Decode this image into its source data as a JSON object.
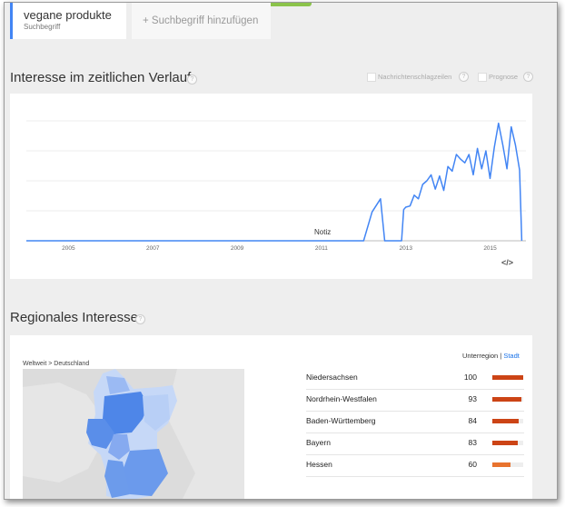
{
  "search": {
    "term": "vegane produkte",
    "term_type": "Suchbegriff",
    "add_term": "+ Suchbegriff hinzufügen"
  },
  "time_section": {
    "title": "Interesse im zeitlichen Verlauf",
    "help_icon": "?",
    "options": [
      "Nachrichtenschlagzeilen",
      "Prognose"
    ],
    "note_label": "Notiz",
    "embed_icon": "</>"
  },
  "chart_data": {
    "type": "line",
    "series": [
      {
        "color": "#4285f4",
        "x": [
          2004.0,
          2012.0,
          2012.2,
          2012.4,
          2012.5,
          2012.7,
          2012.9,
          2012.95,
          2013.0,
          2013.1,
          2013.2,
          2013.3,
          2013.4,
          2013.5,
          2013.6,
          2013.7,
          2013.8,
          2013.9,
          2014.0,
          2014.1,
          2014.2,
          2014.3,
          2014.4,
          2014.5,
          2014.6,
          2014.7,
          2014.8,
          2014.9,
          2015.0,
          2015.1,
          2015.2,
          2015.3,
          2015.4,
          2015.5,
          2015.6,
          2015.7,
          2015.75
        ],
        "values": [
          0,
          0,
          24,
          35,
          0,
          0,
          0,
          26,
          28,
          29,
          38,
          35,
          47,
          50,
          55,
          43,
          54,
          42,
          62,
          58,
          72,
          68,
          65,
          72,
          55,
          77,
          60,
          75,
          52,
          78,
          98,
          80,
          60,
          95,
          80,
          59,
          0
        ]
      }
    ],
    "x_ticks": [
      "2005",
      "2007",
      "2009",
      "2011",
      "2013",
      "2015"
    ],
    "x_tick_values": [
      2005,
      2007,
      2009,
      2011,
      2013,
      2015
    ],
    "xlim": [
      2004.0,
      2015.85
    ],
    "ylim": [
      0,
      100
    ],
    "grid": true
  },
  "region_section": {
    "title": "Regionales Interesse",
    "help_icon": "?",
    "breadcrumb": "Weltweit > Deutschland",
    "toggle_region": "Unterregion",
    "toggle_city": "Stadt",
    "rows": [
      {
        "name": "Niedersachsen",
        "value": "100",
        "level": 1.0,
        "color": "#cc4416"
      },
      {
        "name": "Nordrhein-Westfalen",
        "value": "93",
        "level": 0.93,
        "color": "#cc4416"
      },
      {
        "name": "Baden-Württemberg",
        "value": "84",
        "level": 0.84,
        "color": "#cc4416"
      },
      {
        "name": "Bayern",
        "value": "83",
        "level": 0.83,
        "color": "#cc4416"
      },
      {
        "name": "Hessen",
        "value": "60",
        "level": 0.6,
        "color": "#e8732e"
      }
    ]
  }
}
